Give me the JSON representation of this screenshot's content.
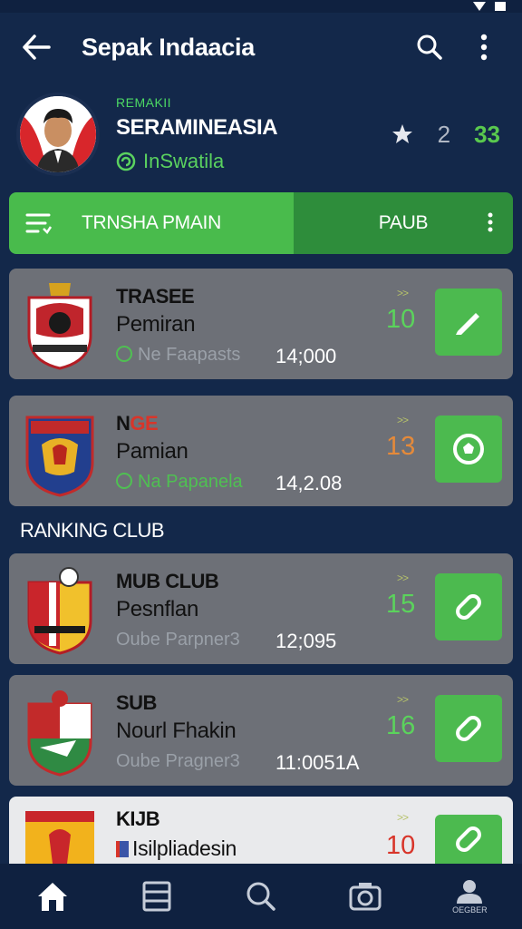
{
  "app": {
    "title": "Sepak Indaacia"
  },
  "profile": {
    "kicker": "REMAKII",
    "name": "SERAMINEASIA",
    "subtitle": "InSwatila",
    "stat_a": "2",
    "stat_b": "33"
  },
  "tabs": [
    {
      "label": "TRNSHA PMAIN"
    },
    {
      "label": "PAUB"
    }
  ],
  "section_title": "RANKING CLUB",
  "cards": [
    {
      "title": "TRASEE",
      "subtitle": "Pemiran",
      "meta": "Ne Faapasts",
      "value": "14;000",
      "arrow": ">>",
      "rank": "10",
      "rank_color": "#5bd35c",
      "meta_color": "gray"
    },
    {
      "title": "NGE",
      "subtitle": "Pamian",
      "meta": "Na Papanela",
      "value": "14,2.08",
      "arrow": ">>",
      "rank": "13",
      "rank_color": "#e58a3a",
      "meta_color": "green"
    },
    {
      "title": "MUB CLUB",
      "subtitle": "Pesnflan",
      "meta": "Oube Parpner3",
      "value": "12;095",
      "arrow": ">>",
      "rank": "15",
      "rank_color": "#5bd35c",
      "meta_color": "gray"
    },
    {
      "title": "SUB",
      "subtitle": "Nourl Fhakin",
      "meta": "Oube Pragner3",
      "value": "11:0051A",
      "arrow": ">>",
      "rank": "16",
      "rank_color": "#5bd35c",
      "meta_color": "gray"
    },
    {
      "title": "KIJB",
      "subtitle": "Isilpliadesin",
      "arrow": ">>",
      "rank": "10",
      "rank_color": "#d8352a"
    }
  ],
  "bottom_nav": [
    {
      "icon": "home-icon"
    },
    {
      "icon": "list-icon"
    },
    {
      "icon": "search-icon"
    },
    {
      "icon": "camera-icon"
    },
    {
      "icon": "profile-icon",
      "label": "OEGBER"
    }
  ],
  "colors": {
    "background": "#13284a",
    "accent": "#4cba4f",
    "card": "#6d7077"
  }
}
